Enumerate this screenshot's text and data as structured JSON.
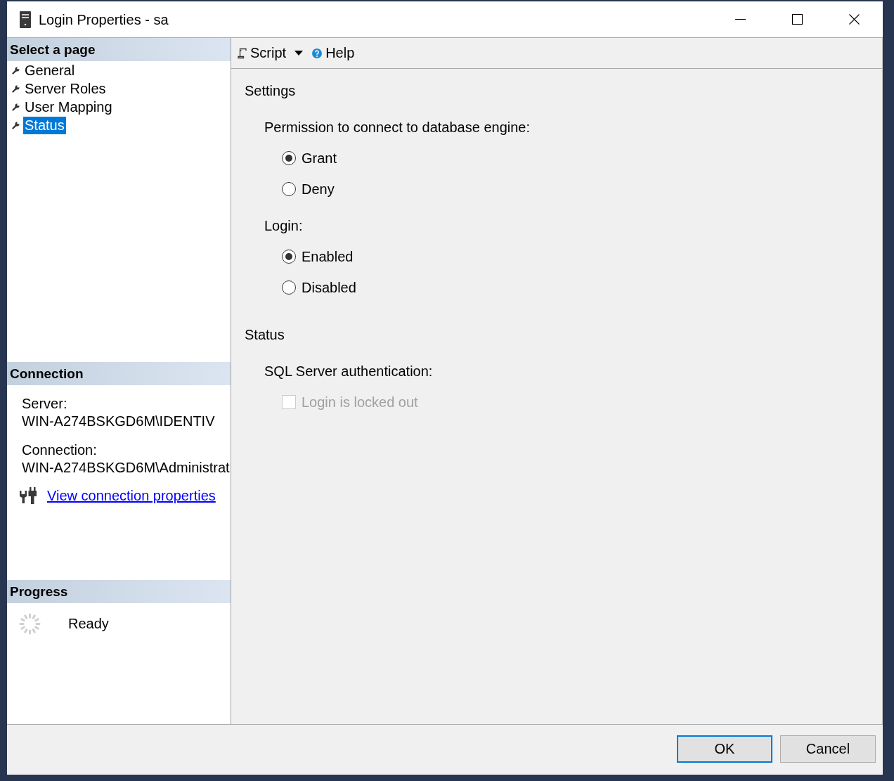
{
  "window": {
    "title": "Login Properties - sa"
  },
  "select_page": {
    "header": "Select a page",
    "items": [
      {
        "label": "General",
        "selected": false
      },
      {
        "label": "Server Roles",
        "selected": false
      },
      {
        "label": "User Mapping",
        "selected": false
      },
      {
        "label": "Status",
        "selected": true
      }
    ]
  },
  "connection": {
    "header": "Connection",
    "fields": [
      {
        "label": "Server:",
        "value": "WIN-A274BSKGD6M\\IDENTIV"
      },
      {
        "label": "Connection:",
        "value": "WIN-A274BSKGD6M\\Administrat"
      }
    ],
    "link": "View connection properties"
  },
  "progress": {
    "header": "Progress",
    "status": "Ready"
  },
  "toolbar": {
    "script": "Script",
    "help": "Help"
  },
  "content": {
    "sections": [
      {
        "title": "Settings",
        "groups": [
          {
            "label": "Permission to connect to database engine:",
            "options": [
              {
                "kind": "radio",
                "label": "Grant",
                "selected": true
              },
              {
                "kind": "radio",
                "label": "Deny",
                "selected": false
              }
            ]
          },
          {
            "label": "Login:",
            "options": [
              {
                "kind": "radio",
                "label": "Enabled",
                "selected": true
              },
              {
                "kind": "radio",
                "label": "Disabled",
                "selected": false
              }
            ]
          }
        ]
      },
      {
        "title": "Status",
        "groups": [
          {
            "label": "SQL Server authentication:",
            "options": [
              {
                "kind": "checkbox",
                "label": "Login is locked out",
                "checked": false,
                "disabled": true
              }
            ]
          }
        ]
      }
    ]
  },
  "buttons": [
    {
      "label": "OK",
      "default": true
    },
    {
      "label": "Cancel",
      "default": false
    }
  ]
}
